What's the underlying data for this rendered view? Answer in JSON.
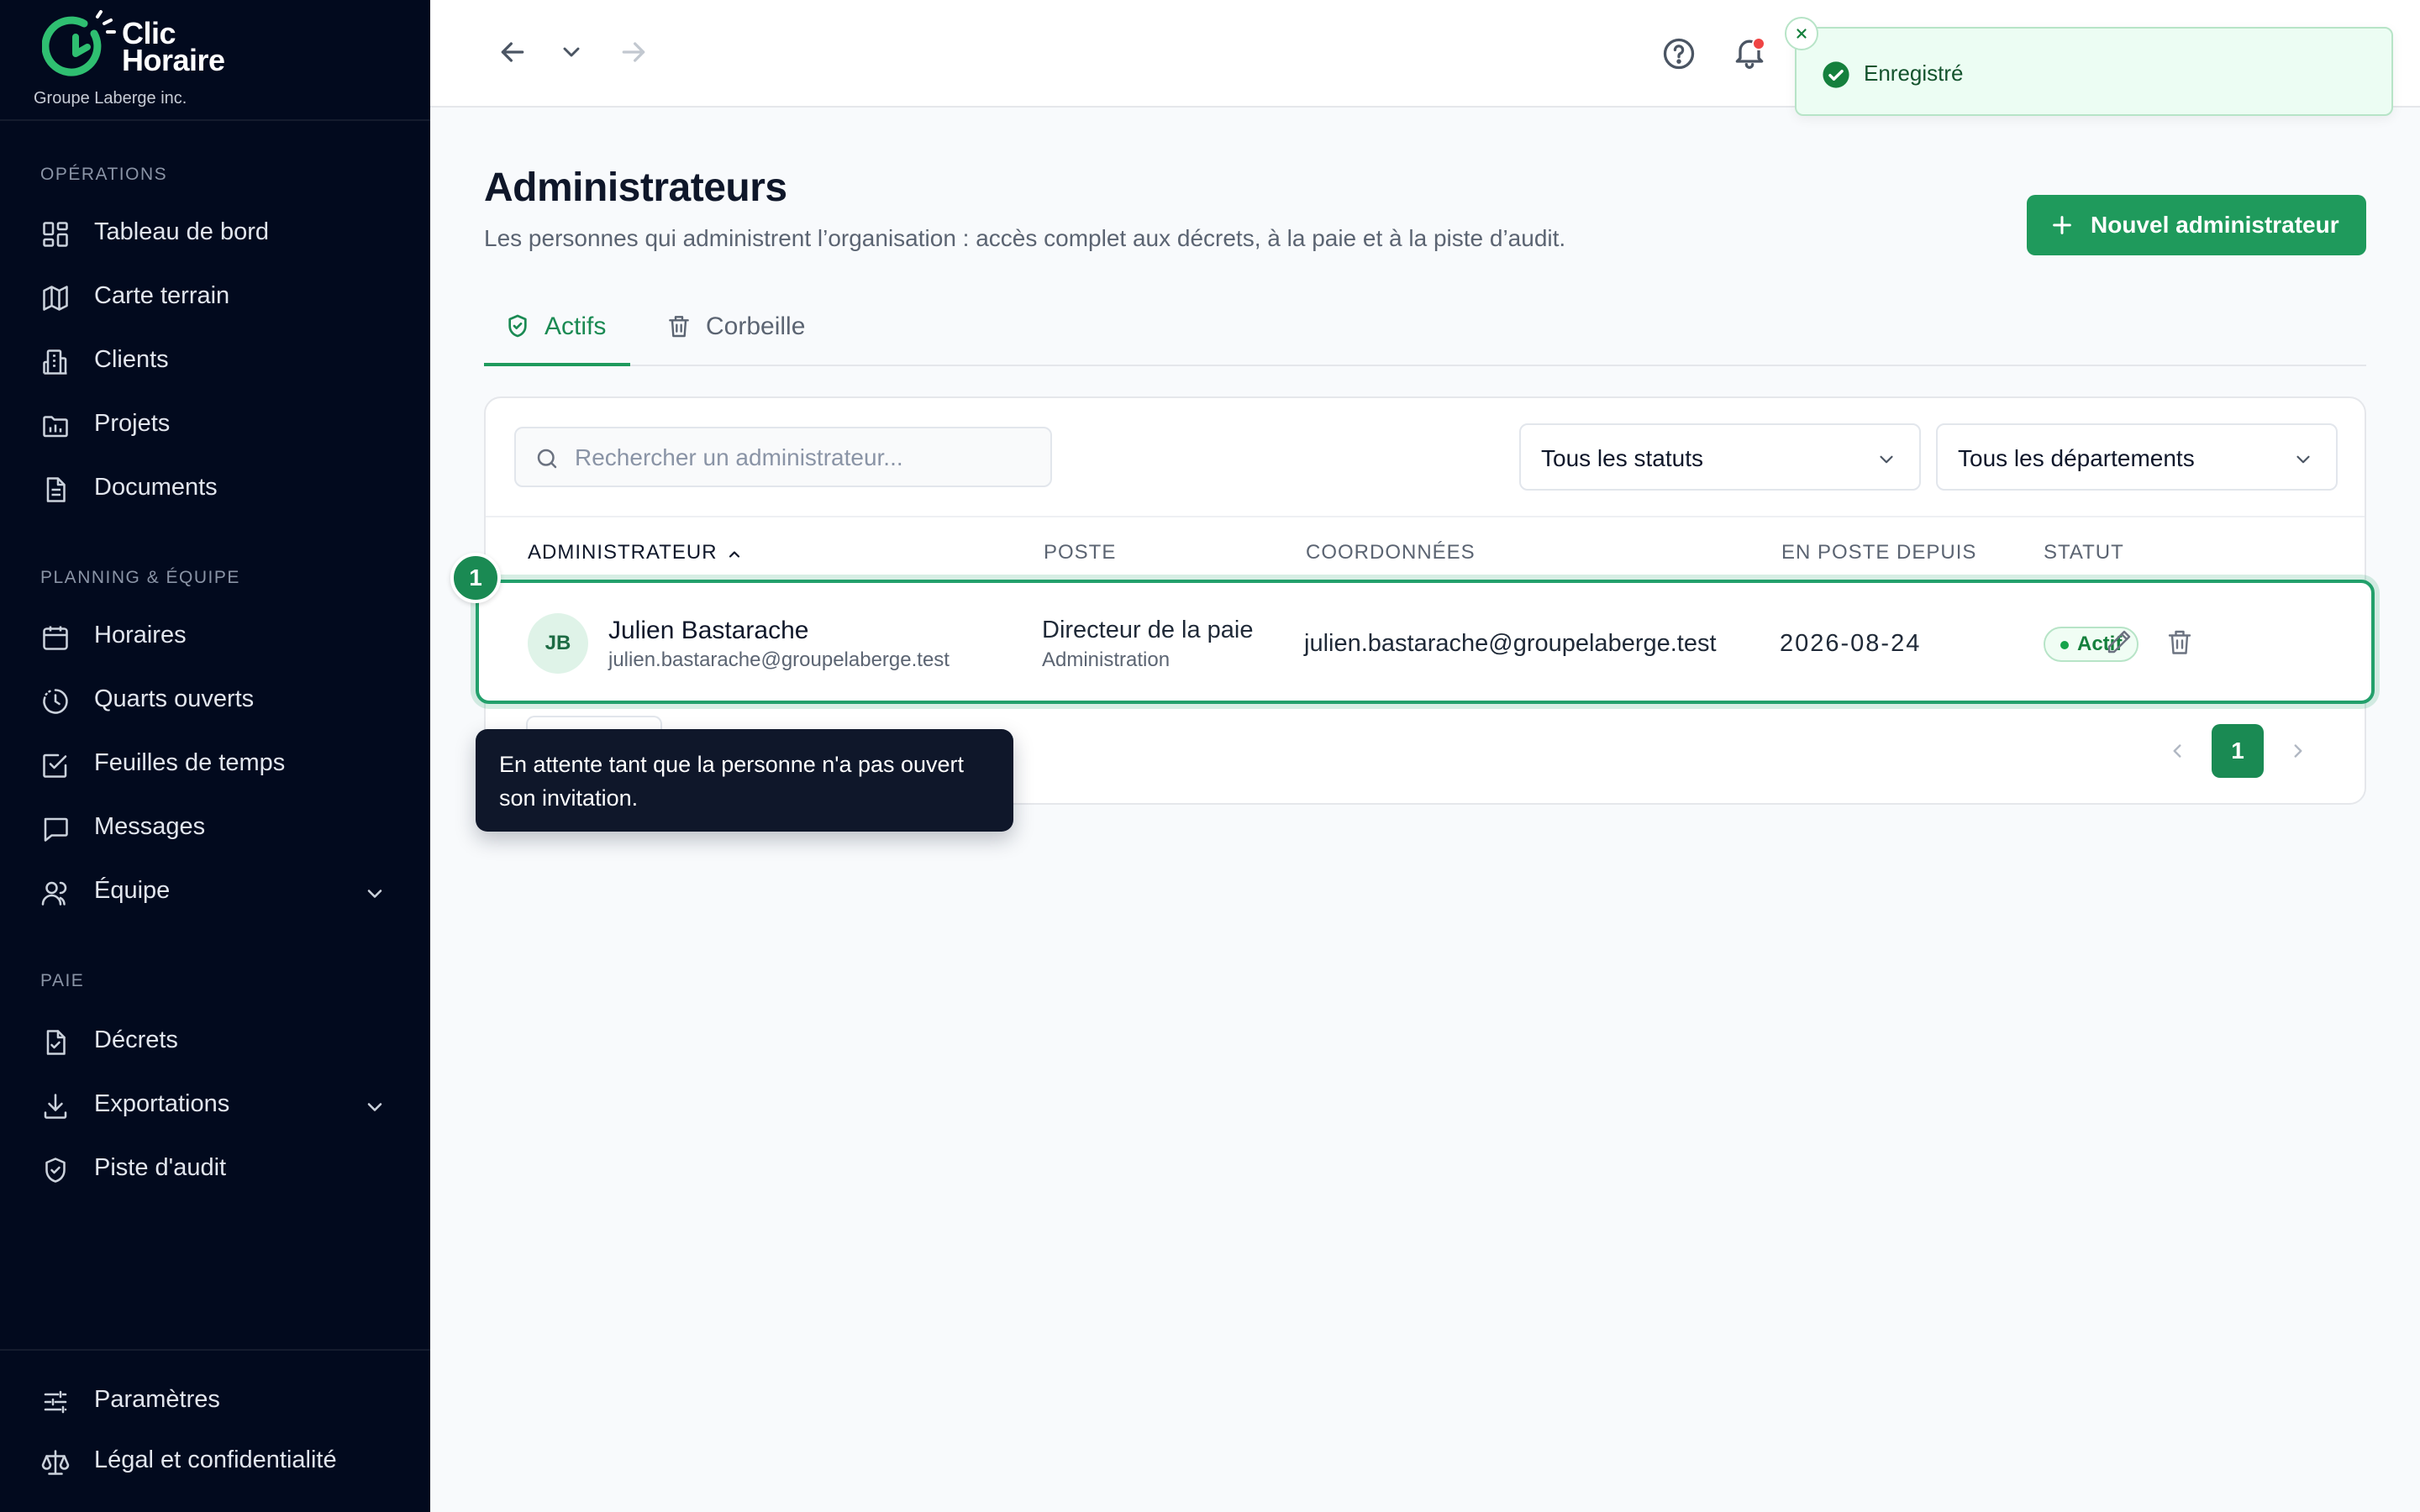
{
  "brand": {
    "line1": "Clic",
    "line2": "Horaire",
    "org": "Groupe Laberge inc."
  },
  "sidebar": {
    "sections": [
      {
        "title": "OPÉRATIONS",
        "items": [
          "Tableau de bord",
          "Carte terrain",
          "Clients",
          "Projets",
          "Documents"
        ]
      },
      {
        "title": "PLANNING & ÉQUIPE",
        "items": [
          "Horaires",
          "Quarts ouverts",
          "Feuilles de temps",
          "Messages",
          "Équipe"
        ]
      },
      {
        "title": "PAIE",
        "items": [
          "Décrets",
          "Exportations",
          "Piste d'audit"
        ]
      }
    ],
    "bottom": [
      "Paramètres",
      "Légal et confidentialité"
    ]
  },
  "toast": {
    "message": "Enregistré"
  },
  "page": {
    "title": "Administrateurs",
    "subtitle": "Les personnes qui administrent l’organisation : accès complet aux décrets, à la paie et à la piste d’audit.",
    "new_button": "Nouvel administrateur"
  },
  "tabs": {
    "active": "Actifs",
    "trash": "Corbeille"
  },
  "filters": {
    "search_placeholder": "Rechercher un administrateur...",
    "status": "Tous les statuts",
    "department": "Tous les départements"
  },
  "table": {
    "headers": [
      "ADMINISTRATEUR",
      "POSTE",
      "COORDONNÉES",
      "EN POSTE DEPUIS",
      "STATUT"
    ],
    "rows": [
      {
        "initials": "JB",
        "name": "Julien Bastarache",
        "email_sub": "julien.bastarache@groupelaberge.test",
        "poste": "Directeur de la paie",
        "department": "Administration",
        "coordonnees": "julien.bastarache@groupelaberge.test",
        "since": "2026-08-24",
        "status": "Actif"
      }
    ]
  },
  "step_badge": "1",
  "tooltip": "En attente tant que la personne n'a pas ouvert son invitation.",
  "pagination": {
    "current": "1"
  },
  "colors": {
    "sidebar_bg": "#020a1e",
    "accent": "#1f9a5c",
    "toast_bg": "#ecfdf3"
  }
}
